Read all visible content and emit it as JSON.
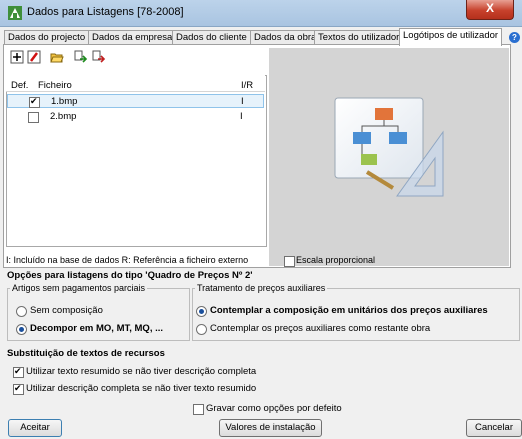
{
  "window": {
    "title": "Dados para Listagens [78-2008]",
    "close_label": "X"
  },
  "tabs": [
    {
      "label": "Dados do projecto"
    },
    {
      "label": "Dados da empresa"
    },
    {
      "label": "Dados do cliente"
    },
    {
      "label": "Dados da obra"
    },
    {
      "label": "Textos do utilizador"
    },
    {
      "label": "Logótipos de utilizador",
      "active": true
    }
  ],
  "help_label": "?",
  "toolbar": {
    "icons": [
      "add-icon",
      "delete-icon",
      "open-folder-icon",
      "import-icon",
      "export-icon"
    ]
  },
  "list": {
    "columns": [
      "Def.",
      "Ficheiro",
      "I/R"
    ],
    "rows": [
      {
        "checked": true,
        "file": "1.bmp",
        "ir": "I"
      },
      {
        "checked": false,
        "file": "2.bmp",
        "ir": "I"
      }
    ]
  },
  "legend": "I: Incluído na base de dados  R: Referência a ficheiro externo",
  "escala_label": "Escala proporcional",
  "options": {
    "title": "Opções para listagens do tipo 'Quadro de Preços Nº 2'",
    "group1": {
      "title": "Artigos sem pagamentos parciais",
      "opt1": "Sem composição",
      "opt2": "Decompor em MO, MT, MQ, ..."
    },
    "group2": {
      "title": "Tratamento de preços auxiliares",
      "opt1": "Contemplar a composição em unitários dos preços auxiliares",
      "opt2": "Contemplar os preços auxiliares como restante obra"
    }
  },
  "subst": {
    "title": "Substituição de textos de recursos",
    "opt1": "Utilizar texto resumido se não tiver descrição completa",
    "opt2": "Utilizar descrição completa se não tiver texto resumido"
  },
  "gravar_label": "Gravar como opções por defeito",
  "buttons": {
    "aceitar": "Aceitar",
    "valores": "Valores de instalação",
    "cancelar": "Cancelar"
  },
  "colors": {
    "accent": "#1a4f9c",
    "selection": "#e6f2fb",
    "preview_bg": "#d4d4d4"
  }
}
